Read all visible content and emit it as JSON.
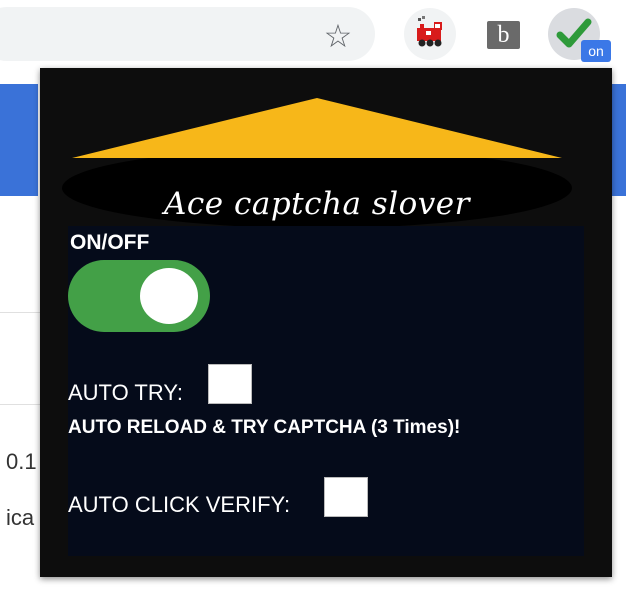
{
  "toolbar": {
    "star_icon": "bookmark-star-icon",
    "extensions": [
      {
        "name": "train-extension-icon"
      },
      {
        "name": "b-extension-icon",
        "glyph": "b"
      },
      {
        "name": "captcha-solver-icon",
        "badge": "on"
      }
    ]
  },
  "background_page": {
    "text_1": "0.1",
    "text_2": "ica"
  },
  "popup": {
    "title": "Ace captcha slover",
    "onoff_label": "ON/OFF",
    "toggle_state": true,
    "auto_try_label": "AUTO TRY:",
    "auto_try_checked": false,
    "reload_note": "AUTO RELOAD & TRY CAPTCHA (3 Times)!",
    "auto_click_label": "AUTO CLICK VERIFY:",
    "auto_click_checked": false
  },
  "colors": {
    "popup_bg": "#0d0d0d",
    "panel_bg": "#050b1a",
    "banner_yellow": "#f7b719",
    "toggle_green": "#43a047",
    "check_green": "#2e9a3a",
    "badge_blue": "#3b78e7",
    "page_blue": "#3a72d8"
  }
}
